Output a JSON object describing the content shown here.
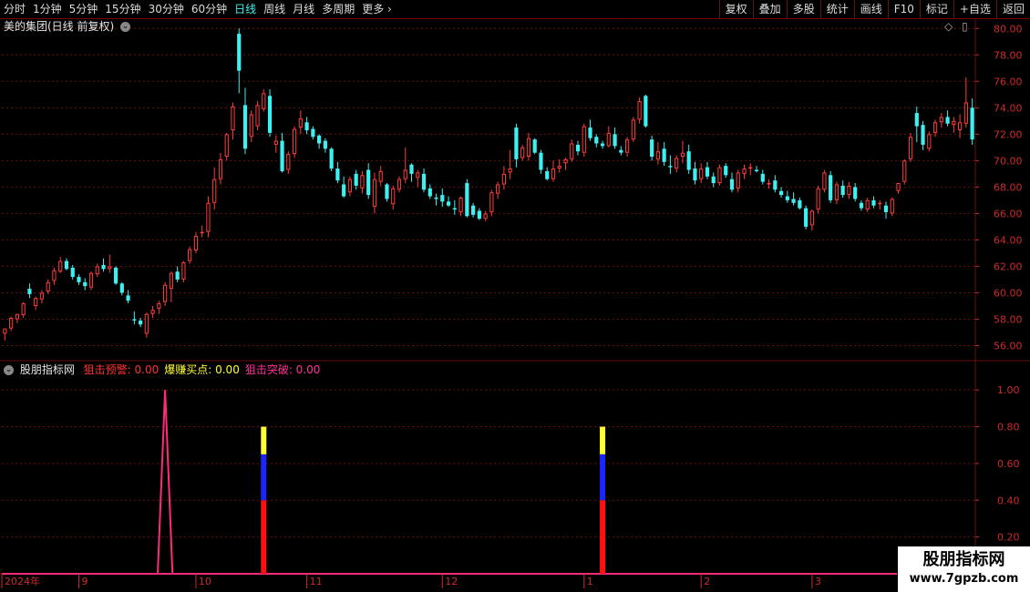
{
  "toolbar": {
    "periods": [
      "分时",
      "1分钟",
      "5分钟",
      "15分钟",
      "30分钟",
      "60分钟",
      "日线",
      "周线",
      "月线",
      "多周期",
      "更多"
    ],
    "active_period": "日线",
    "right_buttons": [
      "复权",
      "叠加",
      "多股",
      "统计",
      "画线",
      "F10",
      "标记",
      "+自选",
      "返回"
    ]
  },
  "main_pane": {
    "title": "美的集团(日线 前复权)",
    "y_labels": [
      "80.00",
      "78.00",
      "76.00",
      "74.00",
      "72.00",
      "70.00",
      "68.00",
      "66.00",
      "64.00",
      "62.00",
      "60.00",
      "58.00",
      "56.00"
    ]
  },
  "indicator_pane": {
    "name": "股朋指标网",
    "items": [
      {
        "label": "狙击预警: 0.00",
        "color": "#ff3333"
      },
      {
        "label": "爆赚买点: 0.00",
        "color": "#ffff33"
      },
      {
        "label": "狙击突破: 0.00",
        "color": "#ff3399"
      }
    ],
    "y_labels": [
      "1.00",
      "0.80",
      "0.60",
      "0.40",
      "0.20"
    ]
  },
  "x_axis": {
    "labels": [
      "2024年",
      "9",
      "10",
      "11",
      "12",
      "1",
      "2",
      "3"
    ]
  },
  "watermark": {
    "line1": "股朋指标网",
    "line2": "www.7gpzb.com"
  },
  "colors": {
    "up": "#ff3c3c",
    "down": "#3ef0f0",
    "grid": "#6a0f0f",
    "axis": "#cc2b2b",
    "peak": "#ff2a7a",
    "bar_red": "#ff1010",
    "bar_blue": "#1b26ff",
    "bar_yellow": "#ffff33"
  },
  "chart_data": {
    "type": "candlestick",
    "y_range": [
      55.0,
      80.5
    ],
    "candles": [
      [
        56.9,
        57.3,
        56.4,
        57.3
      ],
      [
        57.3,
        58.2,
        57.1,
        58.1
      ],
      [
        58.0,
        58.4,
        57.7,
        58.4
      ],
      [
        58.3,
        59.3,
        58.1,
        59.2
      ],
      [
        60.3,
        60.7,
        59.6,
        59.9
      ],
      [
        59.0,
        59.7,
        58.7,
        59.6
      ],
      [
        59.5,
        60.2,
        59.2,
        60.0
      ],
      [
        60.1,
        61.0,
        59.9,
        60.8
      ],
      [
        60.9,
        61.9,
        60.6,
        61.7
      ],
      [
        61.6,
        62.7,
        61.5,
        62.4
      ],
      [
        62.4,
        62.6,
        61.7,
        61.8
      ],
      [
        61.9,
        62.1,
        61.0,
        61.2
      ],
      [
        61.2,
        61.4,
        60.6,
        60.8
      ],
      [
        60.8,
        61.1,
        60.2,
        60.5
      ],
      [
        60.4,
        61.6,
        60.2,
        61.5
      ],
      [
        61.4,
        62.2,
        61.2,
        62.0
      ],
      [
        62.1,
        62.6,
        61.6,
        61.8
      ],
      [
        61.8,
        62.9,
        61.5,
        62.0
      ],
      [
        61.9,
        62.0,
        60.6,
        60.7
      ],
      [
        60.7,
        60.8,
        59.8,
        60.0
      ],
      [
        59.8,
        60.2,
        59.2,
        59.4
      ],
      [
        58.0,
        58.6,
        57.6,
        57.9
      ],
      [
        57.9,
        58.1,
        57.4,
        57.6
      ],
      [
        56.9,
        58.5,
        56.6,
        58.4
      ],
      [
        58.4,
        59.0,
        58.1,
        58.7
      ],
      [
        58.8,
        59.4,
        58.4,
        59.2
      ],
      [
        59.3,
        60.8,
        59.0,
        60.6
      ],
      [
        60.3,
        61.6,
        59.3,
        61.5
      ],
      [
        61.6,
        62.0,
        60.8,
        61.0
      ],
      [
        61.0,
        62.4,
        60.8,
        62.3
      ],
      [
        62.4,
        63.5,
        62.2,
        63.3
      ],
      [
        63.2,
        64.6,
        63.0,
        64.3
      ],
      [
        64.5,
        65.1,
        64.2,
        64.6
      ],
      [
        64.6,
        67.3,
        64.2,
        66.8
      ],
      [
        66.8,
        69.5,
        66.3,
        68.6
      ],
      [
        68.6,
        70.6,
        68.2,
        70.1
      ],
      [
        70.3,
        72.1,
        70.0,
        72.0
      ],
      [
        72.3,
        74.4,
        71.6,
        74.1
      ],
      [
        79.6,
        80.0,
        75.1,
        76.8
      ],
      [
        74.2,
        75.5,
        70.5,
        70.9
      ],
      [
        71.8,
        73.8,
        71.4,
        73.5
      ],
      [
        72.6,
        74.5,
        72.3,
        74.2
      ],
      [
        73.9,
        75.4,
        73.7,
        75.1
      ],
      [
        74.9,
        75.4,
        71.8,
        72.1
      ],
      [
        71.2,
        71.9,
        70.6,
        71.5
      ],
      [
        71.5,
        72.1,
        69.1,
        69.2
      ],
      [
        69.3,
        70.7,
        69.0,
        70.5
      ],
      [
        70.5,
        72.6,
        70.2,
        72.4
      ],
      [
        72.5,
        73.8,
        72.0,
        73.2
      ],
      [
        72.9,
        73.3,
        72.0,
        72.3
      ],
      [
        72.4,
        72.6,
        71.6,
        71.8
      ],
      [
        71.9,
        72.0,
        70.9,
        71.3
      ],
      [
        71.5,
        71.7,
        70.6,
        70.9
      ],
      [
        70.9,
        71.0,
        69.2,
        69.4
      ],
      [
        69.4,
        69.9,
        68.3,
        68.5
      ],
      [
        68.2,
        68.8,
        67.2,
        67.3
      ],
      [
        67.6,
        68.8,
        67.3,
        68.6
      ],
      [
        69.0,
        69.3,
        67.8,
        68.1
      ],
      [
        67.9,
        69.2,
        67.5,
        68.9
      ],
      [
        69.3,
        69.8,
        67.1,
        67.4
      ],
      [
        66.5,
        69.1,
        66.0,
        68.6
      ],
      [
        68.4,
        69.6,
        68.1,
        69.2
      ],
      [
        68.2,
        68.3,
        66.9,
        67.1
      ],
      [
        66.7,
        68.1,
        66.3,
        67.9
      ],
      [
        67.8,
        68.8,
        67.6,
        68.6
      ],
      [
        68.6,
        71.0,
        68.3,
        69.3
      ],
      [
        69.7,
        69.8,
        68.4,
        69.0
      ],
      [
        68.7,
        69.3,
        68.0,
        69.1
      ],
      [
        69.0,
        69.4,
        67.6,
        67.8
      ],
      [
        67.9,
        68.2,
        67.1,
        67.3
      ],
      [
        67.2,
        67.5,
        66.6,
        67.1
      ],
      [
        67.4,
        67.9,
        66.5,
        66.9
      ],
      [
        66.9,
        67.3,
        66.5,
        66.6
      ],
      [
        66.4,
        67.0,
        65.9,
        66.3
      ],
      [
        66.1,
        67.3,
        65.8,
        67.2
      ],
      [
        68.3,
        68.6,
        65.7,
        65.8
      ],
      [
        66.6,
        66.8,
        65.7,
        65.9
      ],
      [
        66.2,
        66.4,
        65.5,
        65.6
      ],
      [
        65.6,
        66.2,
        65.4,
        66.0
      ],
      [
        66.1,
        67.8,
        65.8,
        67.6
      ],
      [
        67.5,
        68.4,
        67.1,
        68.2
      ],
      [
        68.2,
        69.6,
        67.8,
        69.0
      ],
      [
        69.1,
        70.8,
        68.6,
        69.4
      ],
      [
        72.5,
        72.8,
        69.5,
        70.1
      ],
      [
        70.2,
        71.2,
        70.0,
        71.0
      ],
      [
        70.3,
        72.1,
        70.0,
        71.7
      ],
      [
        71.6,
        71.7,
        70.5,
        70.6
      ],
      [
        70.6,
        70.8,
        69.0,
        69.3
      ],
      [
        69.2,
        69.5,
        68.5,
        68.6
      ],
      [
        68.6,
        70.0,
        68.4,
        69.4
      ],
      [
        69.4,
        70.1,
        69.1,
        69.6
      ],
      [
        69.8,
        70.2,
        69.3,
        70.1
      ],
      [
        70.1,
        71.6,
        69.9,
        71.3
      ],
      [
        71.2,
        71.5,
        70.4,
        70.7
      ],
      [
        70.6,
        72.8,
        70.3,
        72.6
      ],
      [
        72.5,
        73.1,
        71.5,
        71.7
      ],
      [
        71.8,
        72.0,
        71.0,
        71.3
      ],
      [
        71.3,
        71.5,
        70.9,
        71.1
      ],
      [
        71.1,
        72.6,
        71.0,
        72.1
      ],
      [
        72.0,
        72.5,
        70.9,
        71.1
      ],
      [
        70.8,
        71.1,
        70.4,
        70.6
      ],
      [
        70.6,
        71.8,
        70.3,
        71.6
      ],
      [
        71.6,
        73.3,
        71.4,
        73.1
      ],
      [
        73.1,
        74.8,
        72.8,
        74.5
      ],
      [
        74.9,
        75.0,
        72.5,
        72.6
      ],
      [
        71.6,
        71.9,
        70.0,
        70.3
      ],
      [
        70.1,
        71.4,
        69.7,
        70.7
      ],
      [
        70.9,
        71.4,
        69.6,
        69.9
      ],
      [
        69.6,
        70.4,
        69.0,
        69.5
      ],
      [
        69.4,
        70.4,
        69.1,
        70.2
      ],
      [
        70.3,
        71.5,
        69.8,
        70.6
      ],
      [
        70.7,
        71.2,
        69.0,
        69.3
      ],
      [
        69.4,
        69.9,
        68.2,
        68.5
      ],
      [
        68.6,
        69.8,
        68.3,
        69.4
      ],
      [
        69.5,
        69.9,
        68.6,
        68.8
      ],
      [
        68.8,
        69.1,
        68.0,
        68.3
      ],
      [
        68.3,
        69.7,
        68.1,
        69.5
      ],
      [
        69.6,
        69.8,
        68.7,
        68.9
      ],
      [
        68.6,
        69.1,
        67.6,
        67.8
      ],
      [
        67.9,
        69.3,
        67.6,
        69.1
      ],
      [
        69.0,
        69.7,
        68.6,
        69.4
      ],
      [
        69.4,
        69.8,
        68.9,
        69.5
      ],
      [
        69.3,
        69.6,
        69.1,
        69.2
      ],
      [
        69.0,
        69.3,
        68.2,
        68.4
      ],
      [
        68.2,
        68.6,
        67.9,
        68.3
      ],
      [
        68.5,
        68.9,
        67.6,
        67.8
      ],
      [
        67.7,
        68.0,
        67.2,
        67.4
      ],
      [
        67.3,
        67.7,
        66.8,
        67.0
      ],
      [
        67.1,
        67.6,
        66.6,
        66.8
      ],
      [
        67.0,
        67.2,
        66.3,
        66.4
      ],
      [
        66.4,
        66.6,
        64.8,
        65.0
      ],
      [
        65.1,
        66.3,
        64.7,
        66.2
      ],
      [
        66.3,
        68.1,
        66.0,
        67.9
      ],
      [
        67.8,
        69.3,
        67.6,
        69.1
      ],
      [
        68.9,
        69.2,
        66.8,
        67.0
      ],
      [
        67.0,
        68.4,
        66.7,
        68.2
      ],
      [
        68.1,
        68.5,
        67.2,
        67.4
      ],
      [
        67.4,
        68.4,
        67.1,
        68.1
      ],
      [
        68.0,
        68.3,
        66.9,
        67.1
      ],
      [
        66.8,
        67.0,
        66.2,
        66.4
      ],
      [
        66.3,
        67.2,
        66.1,
        67.0
      ],
      [
        67.0,
        67.3,
        66.4,
        66.6
      ],
      [
        66.7,
        67.0,
        66.3,
        66.8
      ],
      [
        66.6,
        66.9,
        65.6,
        66.1
      ],
      [
        66.0,
        67.2,
        65.8,
        67.1
      ],
      [
        67.7,
        68.3,
        67.5,
        68.3
      ],
      [
        68.4,
        70.1,
        68.2,
        70.0
      ],
      [
        70.1,
        72.1,
        69.9,
        71.8
      ],
      [
        73.6,
        74.1,
        71.4,
        72.6
      ],
      [
        72.7,
        73.0,
        70.8,
        71.2
      ],
      [
        70.9,
        72.2,
        70.7,
        72.0
      ],
      [
        72.1,
        73.1,
        71.8,
        72.9
      ],
      [
        72.9,
        73.6,
        72.5,
        73.3
      ],
      [
        73.3,
        73.8,
        72.6,
        72.8
      ],
      [
        72.7,
        73.3,
        72.1,
        73.0
      ],
      [
        72.3,
        73.5,
        71.7,
        72.9
      ],
      [
        72.8,
        76.3,
        72.5,
        74.4
      ],
      [
        74.0,
        74.7,
        71.2,
        71.6
      ]
    ],
    "indicator": {
      "peak_index": 26,
      "peak_value": 1.0,
      "signal_indices": [
        42,
        97
      ],
      "signal_stack": [
        {
          "name": "red",
          "from": 0.0,
          "to": 0.4
        },
        {
          "name": "blue",
          "from": 0.4,
          "to": 0.65
        },
        {
          "name": "yellow",
          "from": 0.65,
          "to": 0.8
        }
      ],
      "y_range": [
        0.0,
        1.08
      ]
    },
    "x_ticks": [
      {
        "label": "2024年",
        "index": 0
      },
      {
        "label": "9",
        "index": 12
      },
      {
        "label": "10",
        "index": 31
      },
      {
        "label": "11",
        "index": 49
      },
      {
        "label": "12",
        "index": 71
      },
      {
        "label": "1",
        "index": 94
      },
      {
        "label": "2",
        "index": 113
      },
      {
        "label": "3",
        "index": 131
      }
    ]
  }
}
